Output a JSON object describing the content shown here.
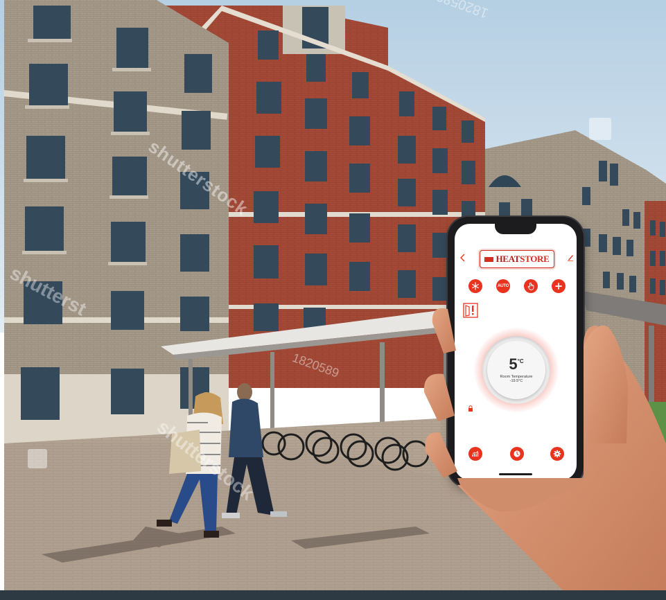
{
  "app": {
    "brand_heat": "HEAT",
    "brand_store": "STORE",
    "modes": [
      {
        "name": "frost-protection",
        "icon": "snowflake-icon"
      },
      {
        "name": "auto",
        "label": "AUTO"
      },
      {
        "name": "manual",
        "icon": "hand-icon"
      },
      {
        "name": "boost",
        "icon": "plus-icon"
      }
    ],
    "temperature": {
      "value": "5",
      "unit": "°C",
      "label": "Room Temperature",
      "reading": "-19.5°C"
    },
    "bottom_nav": [
      {
        "name": "statistics",
        "icon": "chart-icon"
      },
      {
        "name": "schedule",
        "icon": "clock-icon"
      },
      {
        "name": "settings",
        "icon": "gear-icon"
      }
    ]
  },
  "watermarks": [
    "shutterstock",
    "shutterst",
    "1820589"
  ],
  "colors": {
    "accent": "#e8341f",
    "brand_red": "#d62b1f",
    "sky": "#cfe0ee",
    "brick": "#a24a38",
    "bottom_bar": "#2d3a43"
  }
}
